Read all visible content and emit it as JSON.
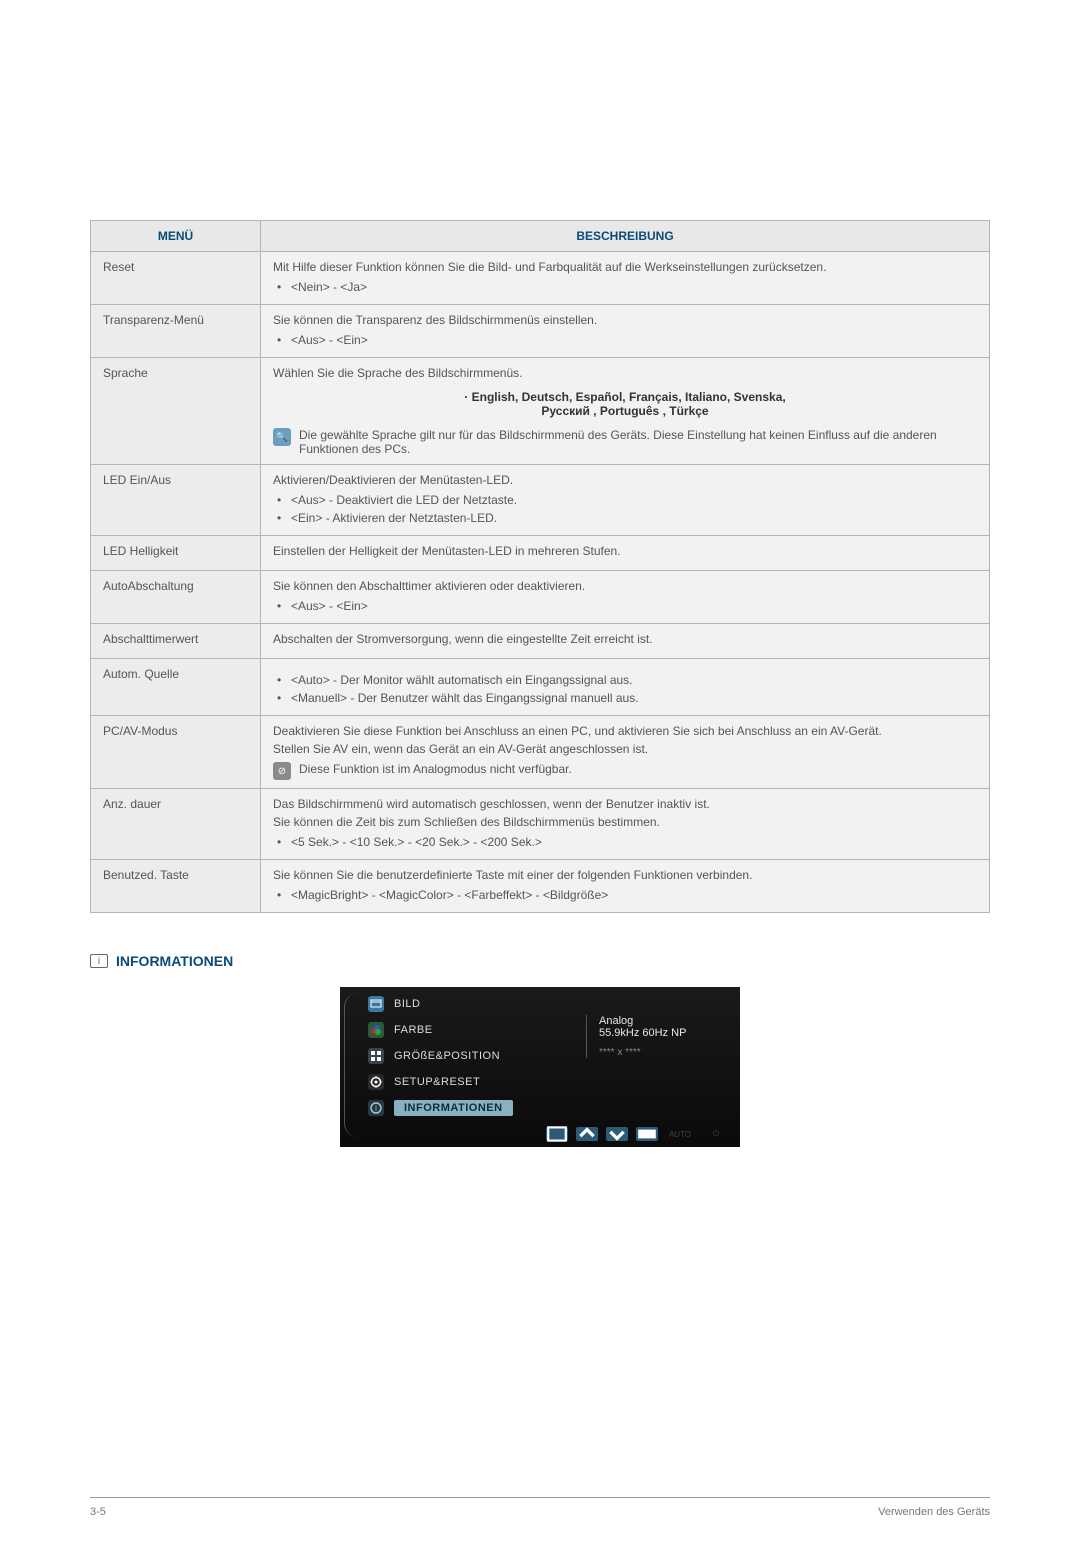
{
  "table": {
    "headers": {
      "menu": "MENÜ",
      "desc": "BESCHREIBUNG"
    },
    "rows": [
      {
        "label": "Reset",
        "desc": "Mit Hilfe dieser Funktion können Sie die Bild- und Farbqualität auf die Werkseinstellungen zurücksetzen.",
        "bullets": [
          "<Nein> - <Ja>"
        ]
      },
      {
        "label": "Transparenz-Menü",
        "desc": "Sie können die Transparenz des Bildschirmmenüs einstellen.",
        "bullets": [
          "<Aus> - <Ein>"
        ]
      },
      {
        "label": "Sprache",
        "desc": "Wählen Sie die Sprache des Bildschirmmenüs.",
        "lang_list": "· English, Deutsch, Español, Français,  Italiano, Svenska,\nРусский , Português , Türkçe",
        "note_icon": "blue",
        "note": "Die gewählte Sprache gilt nur für das Bildschirmmenü des Geräts. Diese Einstellung hat keinen Einfluss auf die anderen Funktionen des PCs."
      },
      {
        "label": "LED Ein/Aus",
        "desc": "Aktivieren/Deaktivieren der Menütasten-LED.",
        "bullets": [
          "<Aus> - Deaktiviert die LED der Netztaste.",
          "<Ein> - Aktivieren der Netztasten-LED."
        ]
      },
      {
        "label": "LED Helligkeit",
        "desc": "Einstellen der Helligkeit der Menütasten-LED in mehreren Stufen."
      },
      {
        "label": "AutoAbschaltung",
        "desc": "Sie können den Abschalttimer aktivieren oder deaktivieren.",
        "bullets": [
          "<Aus> - <Ein>"
        ]
      },
      {
        "label": "Abschalttimerwert",
        "desc": "Abschalten der Stromversorgung, wenn die eingestellte Zeit erreicht ist."
      },
      {
        "label": "Autom. Quelle",
        "bullets": [
          "<Auto> - Der Monitor wählt automatisch ein Eingangssignal aus.",
          "<Manuell> - Der Benutzer wählt das Eingangssignal manuell aus."
        ]
      },
      {
        "label": "PC/AV-Modus",
        "desc": "Deaktivieren Sie diese Funktion bei Anschluss an einen PC, und aktivieren Sie sich bei Anschluss an ein AV-Gerät.",
        "desc2": "Stellen Sie AV ein, wenn das Gerät an ein AV-Gerät angeschlossen ist.",
        "note_icon": "gray",
        "note": "Diese Funktion ist im Analogmodus nicht verfügbar."
      },
      {
        "label": "Anz. dauer",
        "desc": "Das Bildschirmmenü wird automatisch geschlossen, wenn der Benutzer inaktiv ist.",
        "desc2": "Sie können die Zeit bis zum Schließen des Bildschirmmenüs bestimmen.",
        "bullets": [
          "<5 Sek.> - <10 Sek.> - <20 Sek.> - <200 Sek.>"
        ]
      },
      {
        "label": "Benutzed. Taste",
        "desc": "Sie können Sie die benutzerdefinierte Taste mit einer der folgenden Funktionen verbinden.",
        "bullets": [
          "<MagicBright> - <MagicColor> - <Farbeffekt> - <Bildgröße>"
        ]
      }
    ]
  },
  "section2": {
    "title": "INFORMATIONEN"
  },
  "osd": {
    "items": [
      {
        "label": "BILD",
        "icon_bg": "#3a7aa0"
      },
      {
        "label": "FARBE",
        "icon_bg": "#2a5a3a"
      },
      {
        "label": "GRÖßE&POSITION",
        "icon_bg": "#3a4550"
      },
      {
        "label": "SETUP&RESET",
        "icon_bg": "#2a2a2a"
      },
      {
        "label": "INFORMATIONEN",
        "icon_bg": "#2a3540",
        "selected": true
      }
    ],
    "right": {
      "line1": "Analog",
      "line2": "55.9kHz 60Hz NP",
      "line3": "**** x ****"
    },
    "bottom_plain": "AUTO",
    "bottom_power": "⏻"
  },
  "footer": {
    "left": "3-5",
    "right": "Verwenden des Geräts"
  }
}
